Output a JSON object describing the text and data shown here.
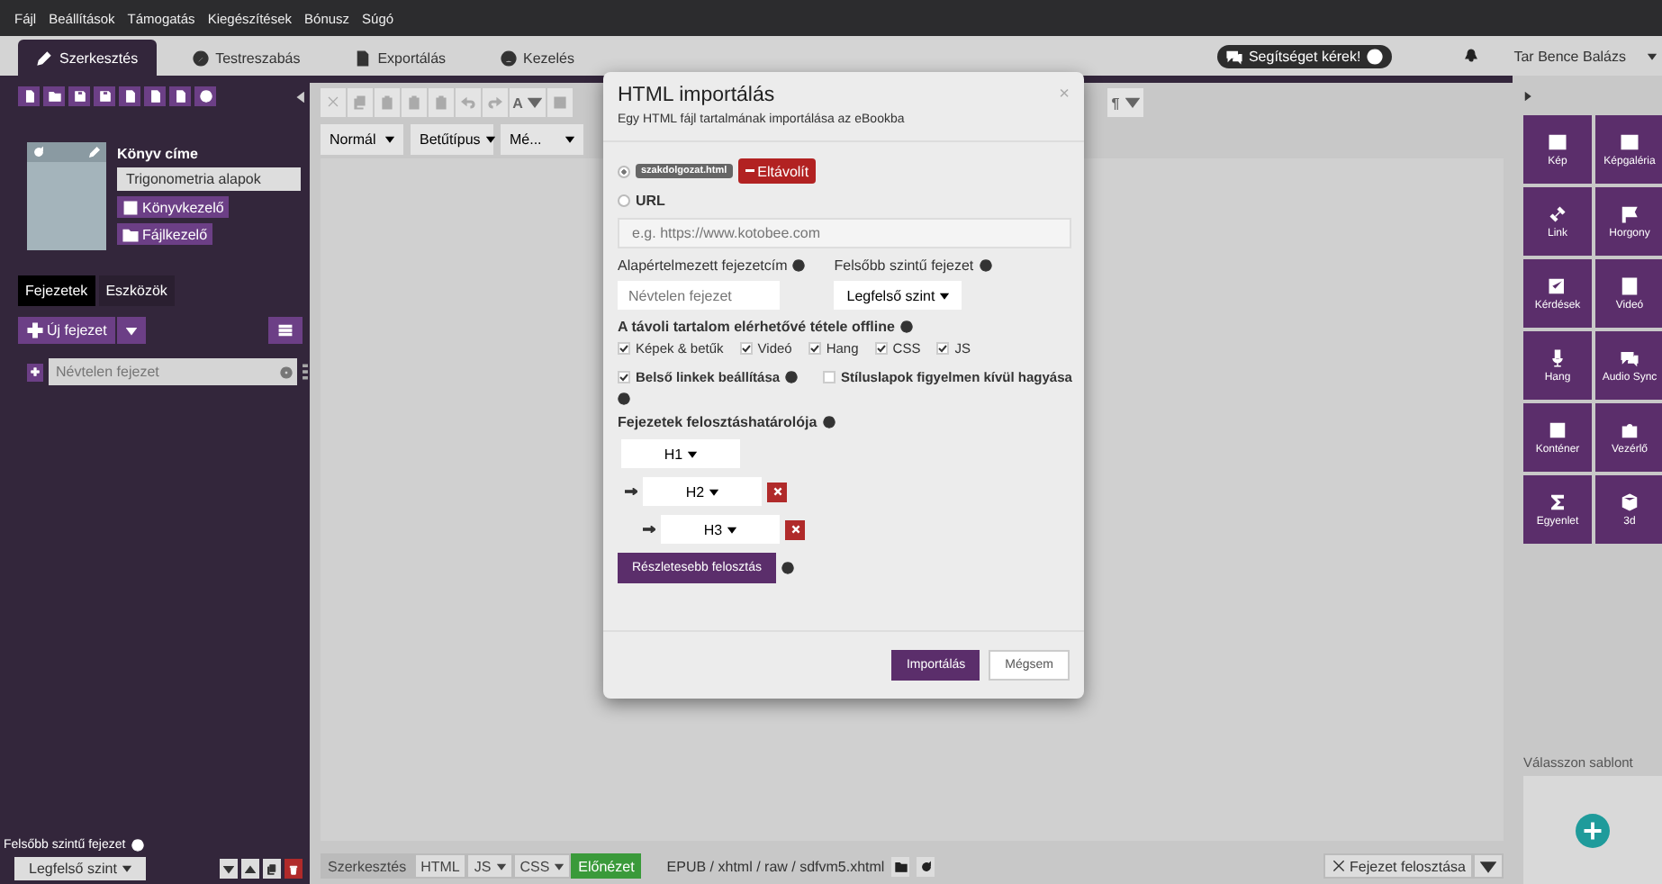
{
  "menu": [
    "Fájl",
    "Beállítások",
    "Támogatás",
    "Kiegészítések",
    "Bónusz",
    "Súgó"
  ],
  "tabs": [
    {
      "label": "Szerkesztés",
      "selected": true
    },
    {
      "label": "Testreszabás",
      "selected": false
    },
    {
      "label": "Exportálás",
      "selected": false
    },
    {
      "label": "Kezelés",
      "selected": false
    }
  ],
  "help_button": "Segítséget kérek!",
  "user": "Tar Bence Balázs",
  "sidebar": {
    "book_title_label": "Könyv címe",
    "book_title": "Trigonometria alapok",
    "buttons": [
      "Könyvkezelő",
      "Fájlkezelő"
    ],
    "tabs": [
      {
        "label": "Fejezetek",
        "selected": true
      },
      {
        "label": "Eszközök",
        "selected": false
      }
    ],
    "new_chapter": "Új fejezet",
    "chapters": [
      {
        "placeholder": "Névtelen fejezet"
      }
    ],
    "parent_label": "Felsőbb szintű fejezet",
    "parent_select": "Legfelső szint"
  },
  "editor": {
    "text_color": "A",
    "paragraph": "¶",
    "selects": [
      "Normál",
      "Betűtípus",
      "Mé..."
    ],
    "mode_tabs": [
      {
        "label": "Szerkesztés",
        "selected": true,
        "dropdown": false
      },
      {
        "label": "HTML",
        "selected": false,
        "dropdown": false
      },
      {
        "label": "JS",
        "selected": false,
        "dropdown": true
      },
      {
        "label": "CSS",
        "selected": false,
        "dropdown": true
      }
    ],
    "preview_button": "Előnézet",
    "path": "EPUB / xhtml / raw / sdfvm5.xhtml",
    "split_button": "Fejezet felosztása"
  },
  "modal": {
    "title": "HTML importálás",
    "subtitle": "Egy HTML fájl tartalmának importálása az eBookba",
    "close": "×",
    "sources": [
      {
        "kind": "file",
        "selected": true,
        "file": "szakdolgozat.html",
        "remove": "Eltávolít"
      },
      {
        "kind": "url",
        "selected": false,
        "label": "URL",
        "placeholder": "e.g. https://www.kotobee.com"
      }
    ],
    "default_title": {
      "label": "Alapértelmezett fejezetcím",
      "placeholder": "Névtelen fejezet"
    },
    "parent": {
      "label": "Felsőbb szintű fejezet",
      "value": "Legfelső szint"
    },
    "offline": {
      "label": "A távoli tartalom elérhetővé tétele offline",
      "options": [
        {
          "label": "Képek & betűk",
          "checked": true
        },
        {
          "label": "Videó",
          "checked": true
        },
        {
          "label": "Hang",
          "checked": true
        },
        {
          "label": "CSS",
          "checked": true
        },
        {
          "label": "JS",
          "checked": true
        }
      ]
    },
    "options": [
      {
        "label": "Belső linkek beállítása",
        "checked": true
      },
      {
        "label": "Stíluslapok figyelmen kívül hagyása",
        "checked": false
      }
    ],
    "splitter": {
      "label": "Fejezetek felosztáshatárolója",
      "levels": [
        {
          "value": "H1",
          "removable": false,
          "children": [
            {
              "value": "H2",
              "removable": true,
              "children": [
                {
                  "value": "H3",
                  "removable": true
                }
              ]
            }
          ]
        }
      ]
    },
    "more_button": "Részletesebb felosztás",
    "import_button": "Importálás",
    "cancel_button": "Mégsem"
  },
  "widgets": [
    "Kép",
    "Képgaléria",
    "Link",
    "Horgony",
    "Kérdések",
    "Videó",
    "Hang",
    "Audio Sync",
    "Konténer",
    "Vezérlő",
    "Egyenlet",
    "3d"
  ],
  "template_label": "Válasszon sablont"
}
